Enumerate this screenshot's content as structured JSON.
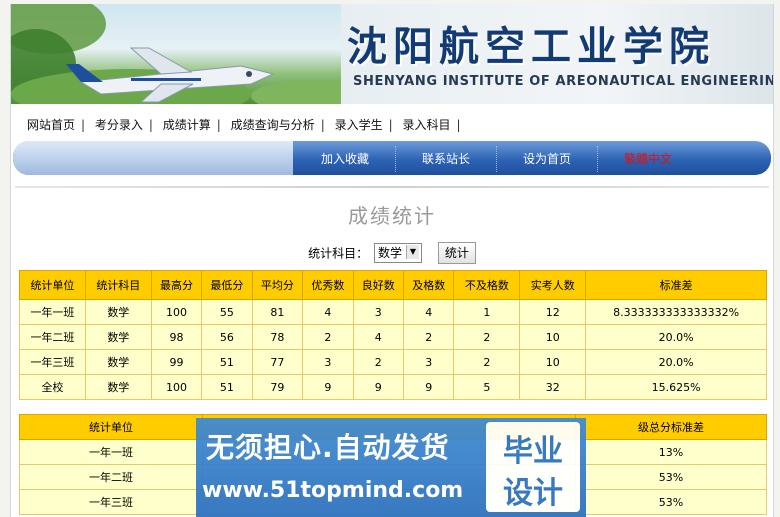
{
  "header": {
    "school_cn": "沈阳航空工业学院",
    "school_en": "SHENYANG INSTITUTE OF AREONAUTICAL ENGINEERING"
  },
  "nav": {
    "items": [
      "网站首页",
      "考分录入",
      "成绩计算",
      "成绩查询与分析",
      "录入学生",
      "录入科目"
    ]
  },
  "quick_links": {
    "add_favorite": "加入收藏",
    "contact": "联系站长",
    "set_home": "设为首页",
    "traditional": "繁體中文"
  },
  "page": {
    "title": "成绩统计",
    "subject_label": "统计科目：",
    "subject_value": "数学",
    "stat_button": "统计"
  },
  "stats_table": {
    "headers": [
      "统计单位",
      "统计科目",
      "最高分",
      "最低分",
      "平均分",
      "优秀数",
      "良好数",
      "及格数",
      "不及格数",
      "实考人数",
      "标准差"
    ],
    "rows": [
      [
        "一年一班",
        "数学",
        "100",
        "55",
        "81",
        "4",
        "3",
        "4",
        "1",
        "12",
        "8.333333333333332%"
      ],
      [
        "一年二班",
        "数学",
        "98",
        "56",
        "78",
        "2",
        "4",
        "2",
        "2",
        "10",
        "20.0%"
      ],
      [
        "一年三班",
        "数学",
        "99",
        "51",
        "77",
        "3",
        "2",
        "3",
        "2",
        "10",
        "20.0%"
      ],
      [
        "全校",
        "数学",
        "100",
        "51",
        "79",
        "9",
        "9",
        "9",
        "5",
        "32",
        "15.625%"
      ]
    ]
  },
  "ratio_table": {
    "headers": [
      "统计单位",
      "",
      "级总分标准差"
    ],
    "rows": [
      [
        "一年一班",
        "",
        "13%"
      ],
      [
        "一年二班",
        "",
        "53%"
      ],
      [
        "一年三班",
        "",
        "53%"
      ]
    ]
  },
  "watermark": {
    "line1": "无须担心.自动发货",
    "line2": "www.51topmind.com",
    "badge1": "毕业",
    "badge2": "设计"
  },
  "colors": {
    "table_header": "#ffcc00",
    "table_cell": "#ffffcc",
    "nav_blue": "#2d63b5"
  }
}
